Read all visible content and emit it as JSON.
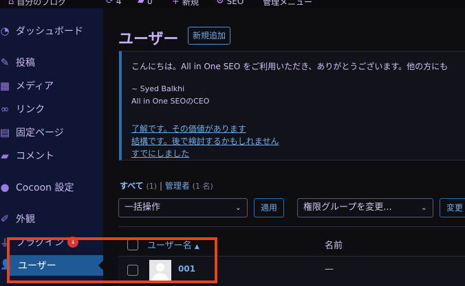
{
  "adminbar": {
    "site_name": "自分のブログ",
    "updates_count": "4",
    "comments_count": "0",
    "new_label": "新規",
    "seo_label": "SEO",
    "admin_menu_label": "管理メニュー"
  },
  "sidebar": {
    "items": [
      {
        "label": "ダッシュボード",
        "icon": "dashboard-icon"
      },
      {
        "label": "投稿",
        "icon": "pin-icon"
      },
      {
        "label": "メディア",
        "icon": "media-icon"
      },
      {
        "label": "リンク",
        "icon": "link-icon"
      },
      {
        "label": "固定ページ",
        "icon": "page-icon"
      },
      {
        "label": "コメント",
        "icon": "comment-icon"
      },
      {
        "label": "Cocoon 設定",
        "icon": "cocoon-icon"
      },
      {
        "label": "外観",
        "icon": "brush-icon"
      },
      {
        "label": "プラグイン",
        "icon": "plugin-icon",
        "badge": "1"
      },
      {
        "label": "ユーザー",
        "icon": "user-icon",
        "current": true
      }
    ]
  },
  "main": {
    "title": "ユーザー",
    "add_new": "新規追加",
    "notice": {
      "message": "こんにちは。All in One SEO をご利用いただき、ありがとうございます。他の方にも",
      "signature_name": "~ Syed Balkhi",
      "signature_role": "All in One SEOのCEO",
      "links": [
        "了解です。その価値があります",
        "結構です。後で検討するかもしれません",
        "すでにしました"
      ]
    },
    "filters": {
      "all_label": "すべて",
      "all_count": "(1)",
      "separator": "|",
      "admin_label": "管理者",
      "admin_count": "(1 名)"
    },
    "bulk_action": "一括操作",
    "apply": "適用",
    "role_change": "権限グループを変更...",
    "change": "変更",
    "table": {
      "columns": {
        "username": "ユーザー名",
        "sort_indicator": "▲",
        "name": "名前"
      },
      "rows": [
        {
          "username": "001",
          "name": "—"
        }
      ]
    }
  },
  "colors": {
    "accent": "#72aee6",
    "highlight": "#e8431e",
    "current_menu": "#1e5b96"
  }
}
